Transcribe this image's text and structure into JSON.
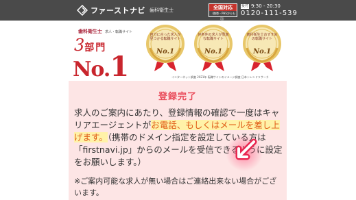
{
  "header": {
    "logo_text": "ファーストナビ",
    "logo_sub": "歯科衛生士",
    "badge_line1": "全国対応",
    "badge_line2": "（携帯・PHSからも可）",
    "hours_tag": "受付",
    "hours": "9:30 - 20:30",
    "phone": "0120-111-539"
  },
  "hero": {
    "tagline": "歯科衛生士",
    "tagline_small": "求人・転職サイト",
    "rank_number": "3",
    "rank_unit": "部門",
    "no_label": "No.",
    "one_label": "1",
    "medals": [
      {
        "text": "自分に合った求人が見つかる転職サイト",
        "no": "No.1"
      },
      {
        "text": "好条件の求人が豊富な転職サイト",
        "no": "No.1"
      },
      {
        "text": "歯科衛生士おすすめの転職サイト",
        "no": "No.1"
      }
    ],
    "footnote": "インターネット調査 2021年 転職サイトのイメージ調査 日本トレンドリサーチ"
  },
  "section": {
    "title": "登録完了",
    "para_1": "求人のご案内にあたり、登録情報の確認で一度はキャリアエージェントが",
    "para_hl": "お電話、もしくはメールを差し上げます。",
    "para_2": "（携帯のドメイン指定を設定している方は「firstnavi.jp」からのメールを受信できるように設定をお願いします。）",
    "note": "※ご案内可能な求人が無い場合はご連絡出来ない場合がございます。"
  },
  "colors": {
    "header_bg": "#4a4a4a",
    "accent_red": "#c8252d",
    "title_pink": "#e94b5a",
    "panel_bg": "#fde5e5",
    "highlight": "#e05a14"
  }
}
